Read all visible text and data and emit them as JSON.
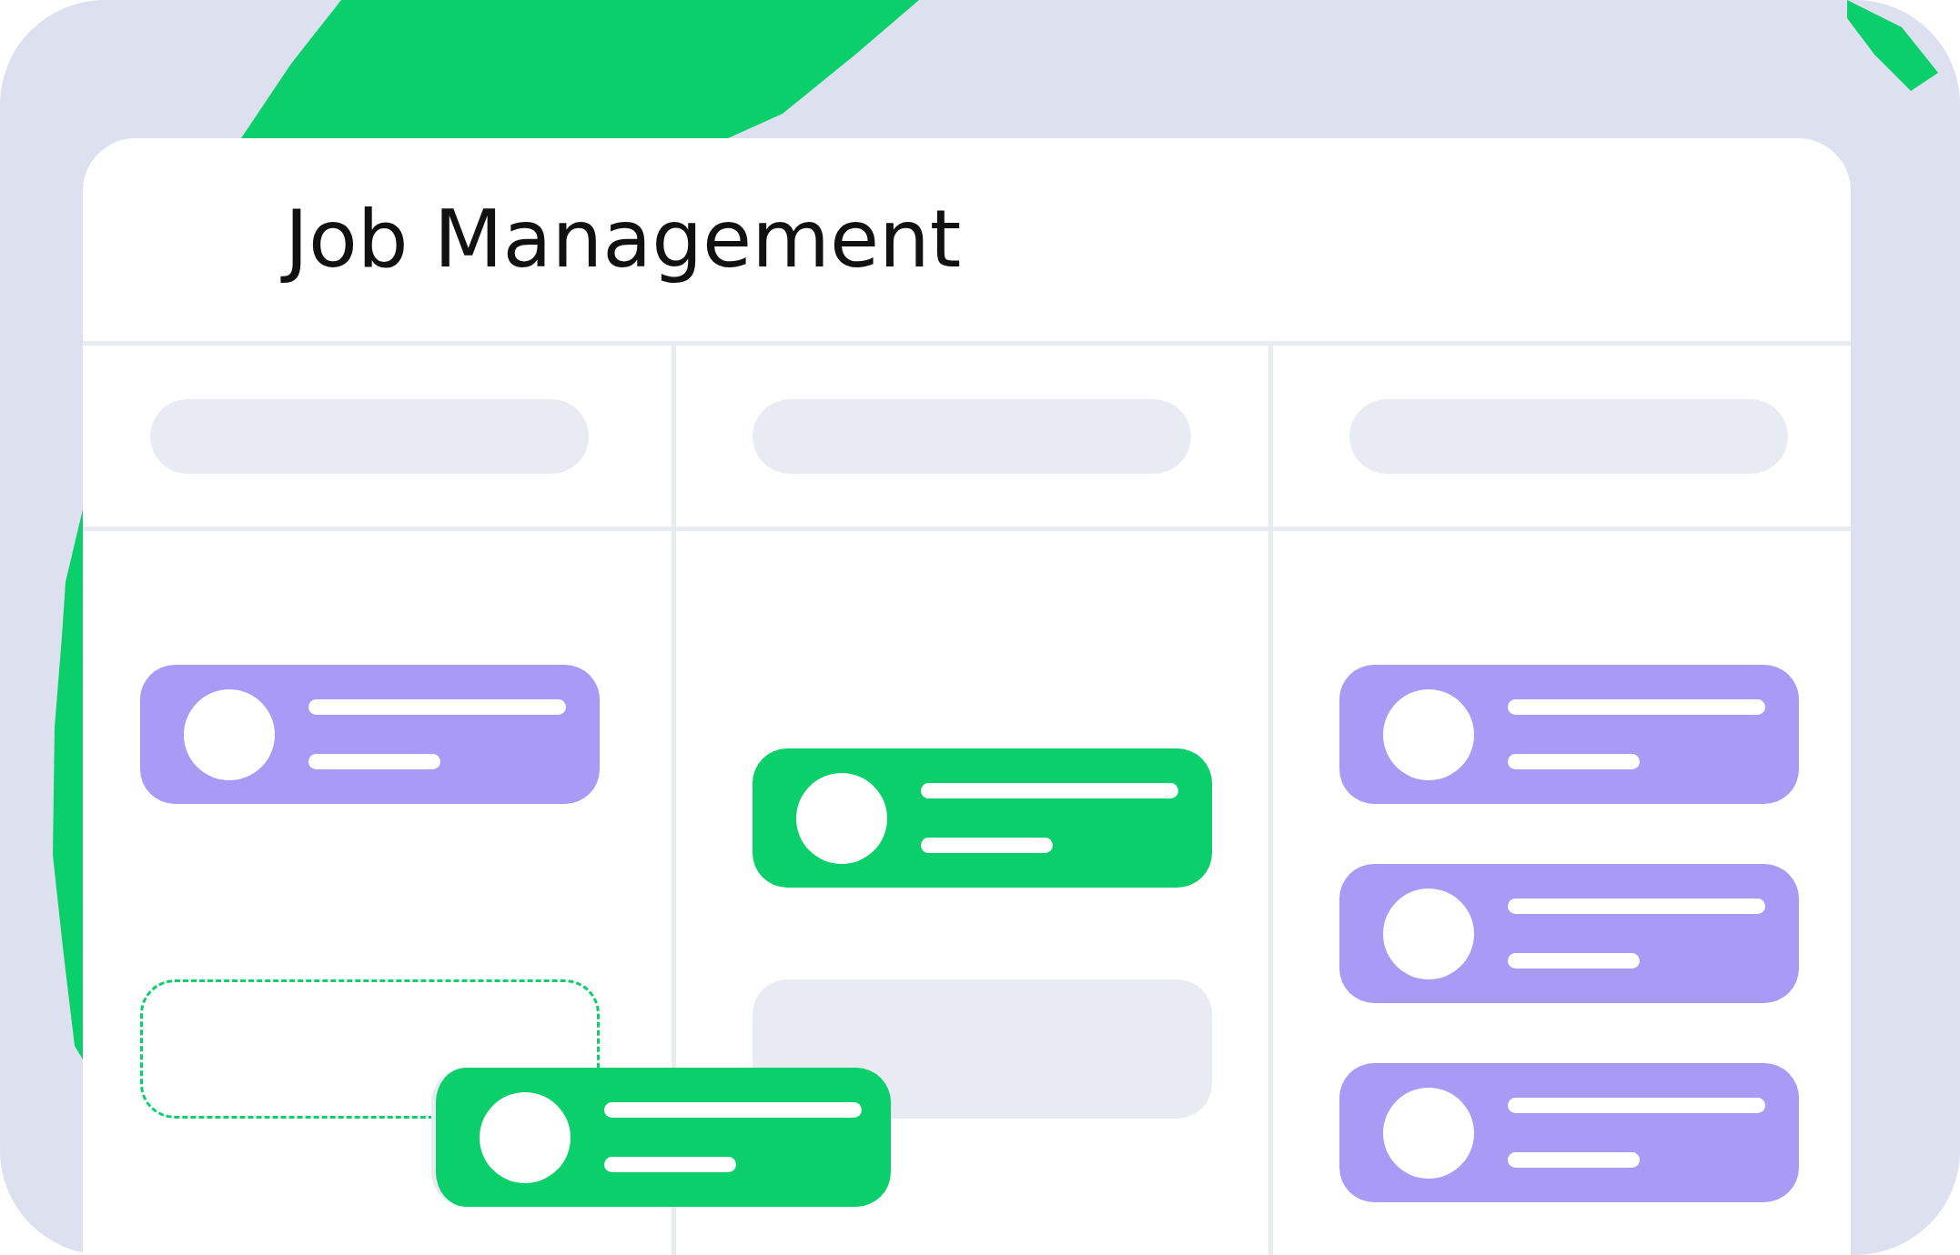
{
  "title": "Job Management",
  "columns": [
    {
      "cards": [
        {
          "kind": "card",
          "color": "#a99af5"
        },
        {
          "kind": "drop-target",
          "color": "#0acf6a"
        }
      ]
    },
    {
      "cards": [
        {
          "kind": "card",
          "color": "#0acf6a"
        },
        {
          "kind": "placeholder",
          "color": "#e9ebf3"
        }
      ]
    },
    {
      "cards": [
        {
          "kind": "card",
          "color": "#a99af5"
        },
        {
          "kind": "card",
          "color": "#a99af5"
        },
        {
          "kind": "card",
          "color": "#a99af5"
        }
      ]
    }
  ],
  "dragged_card": {
    "color": "#0acf6a"
  }
}
